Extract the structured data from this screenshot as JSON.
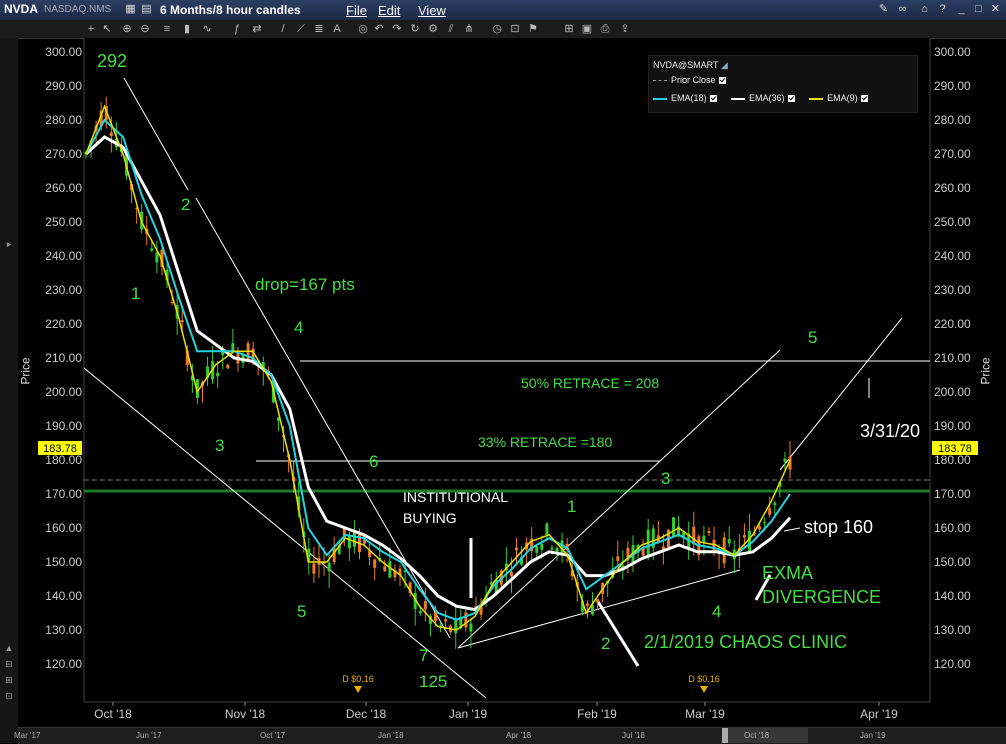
{
  "titlebar": {
    "symbol": "NVDA",
    "exchange": "NASDAQ.NMS",
    "period": "6 Months/8 hour candles",
    "menus": [
      "File",
      "Edit",
      "View"
    ]
  },
  "legend": {
    "title": "NVDA@SMART",
    "prior_close": "Prior Close",
    "ema18": "EMA(18)",
    "ema36": "EMA(36)",
    "ema9": "EMA(9)"
  },
  "axis": {
    "y_label": "Price",
    "y_ticks": [
      "300.00",
      "290.00",
      "280.00",
      "270.00",
      "260.00",
      "250.00",
      "240.00",
      "230.00",
      "220.00",
      "210.00",
      "200.00",
      "190.00",
      "180.00",
      "170.00",
      "160.00",
      "150.00",
      "140.00",
      "130.00",
      "120.00"
    ],
    "x_ticks": [
      "Oct '18",
      "Nov '18",
      "Dec '18",
      "Jan '19",
      "Feb '19",
      "Mar '19",
      "Apr '19"
    ],
    "current_price": "183.78"
  },
  "dividends": [
    "D $0.16",
    "D $0.16"
  ],
  "overview_ticks": [
    "Mar '17",
    "Jun '17",
    "Oct '17",
    "Jan '18",
    "Apr '18",
    "Jul '18",
    "Oct '18",
    "Jan '19"
  ],
  "annotations": {
    "peak": "292",
    "w1": "1",
    "w2": "2",
    "w3": "3",
    "w4": "4",
    "w5": "5",
    "drop": "drop=167 pts",
    "six": "6",
    "seven": "7",
    "low": "125",
    "inst1": "INSTITUTIONAL",
    "inst2": "BUYING",
    "r1": "1",
    "r2": "2",
    "r3": "3",
    "r4": "4",
    "r5": "5",
    "retrace50": "50% RETRACE = 208",
    "retrace33": "33% RETRACE =180",
    "date": "3/31/20",
    "stop": "stop 160",
    "exma1": "EXMA",
    "exma2": "DIVERGENCE",
    "clinic": "2/1/2019 CHAOS CLINIC"
  },
  "colors": {
    "ema9": "#e8e000",
    "ema18": "#22d4e0",
    "ema36": "#ffffff",
    "annotation_green": "#44dd44",
    "support_line": "#1f7a2a"
  },
  "chart_data": {
    "type": "candlestick",
    "title": "",
    "ylim": [
      115,
      304
    ],
    "series": [
      {
        "name": "EMA(9)",
        "values": [
          270,
          284,
          270,
          250,
          240,
          222,
          200,
          208,
          212,
          212,
          203,
          180,
          150,
          150,
          157,
          155,
          150,
          146,
          137,
          131,
          130,
          134,
          144,
          150,
          156,
          158,
          152,
          135,
          143,
          150,
          155,
          157,
          160,
          156,
          155,
          152,
          158,
          168,
          180
        ]
      },
      {
        "name": "EMA(18)",
        "values": [
          270,
          280,
          275,
          258,
          245,
          228,
          212,
          212,
          212,
          210,
          205,
          190,
          160,
          152,
          158,
          157,
          153,
          150,
          142,
          135,
          133,
          135,
          143,
          148,
          154,
          157,
          154,
          142,
          146,
          150,
          154,
          156,
          158,
          155,
          154,
          152,
          156,
          162,
          170
        ]
      },
      {
        "name": "EMA(36)",
        "values": [
          270,
          275,
          272,
          262,
          252,
          235,
          218,
          214,
          210,
          209,
          205,
          195,
          172,
          162,
          160,
          158,
          155,
          151,
          146,
          140,
          137,
          136,
          140,
          145,
          150,
          153,
          152,
          146,
          146,
          148,
          151,
          153,
          155,
          153,
          153,
          152,
          153,
          157,
          163
        ]
      }
    ]
  }
}
